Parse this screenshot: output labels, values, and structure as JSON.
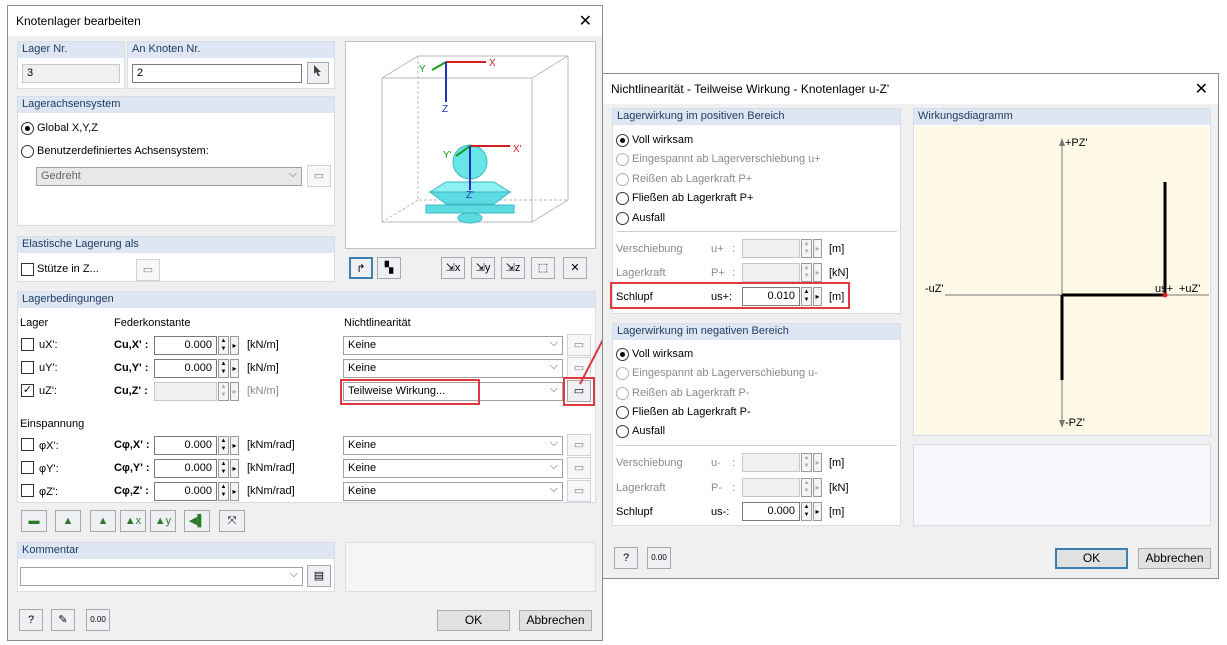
{
  "main": {
    "title": "Knotenlager bearbeiten",
    "lager_nr_label": "Lager Nr.",
    "lager_nr": "3",
    "knoten_label": "An Knoten Nr.",
    "knoten": "2",
    "achs_header": "Lagerachsensystem",
    "global": "Global X,Y,Z",
    "custom": "Benutzerdefiniertes Achsensystem:",
    "custom_dd": "Gedreht",
    "elastic_header": "Elastische Lagerung als",
    "stuetze": "Stütze in Z...",
    "cond_header": "Lagerbedingungen",
    "col_lager": "Lager",
    "col_feder": "Federkonstante",
    "col_nl": "Nichtlinearität",
    "rows": [
      {
        "dof": "uX':",
        "c": "Cu,X' :",
        "val": "0.000",
        "unit": "[kN/m]",
        "nl": "Keine"
      },
      {
        "dof": "uY':",
        "c": "Cu,Y' :",
        "val": "0.000",
        "unit": "[kN/m]",
        "nl": "Keine"
      },
      {
        "dof": "uZ':",
        "c": "Cu,Z' :",
        "val": "",
        "unit": "[kN/m]",
        "nl": "Teilweise Wirkung..."
      }
    ],
    "einsp": "Einspannung",
    "rows2": [
      {
        "dof": "φX':",
        "c": "Cφ,X' :",
        "val": "0.000",
        "unit": "[kNm/rad]",
        "nl": "Keine"
      },
      {
        "dof": "φY':",
        "c": "Cφ,Y' :",
        "val": "0.000",
        "unit": "[kNm/rad]",
        "nl": "Keine"
      },
      {
        "dof": "φZ':",
        "c": "Cφ,Z' :",
        "val": "0.000",
        "unit": "[kNm/rad]",
        "nl": "Keine"
      }
    ],
    "komm_header": "Kommentar",
    "ok": "OK",
    "cancel": "Abbrechen",
    "preview_labels": {
      "x": "X",
      "y": "Y",
      "z": "Z",
      "x2": "X'",
      "y2": "Y'",
      "z2": "Z'"
    }
  },
  "sub": {
    "title": "Nichtlinearität - Teilweise Wirkung - Knotenlager u-Z'",
    "pos_header": "Lagerwirkung im positiven Bereich",
    "pos_opts": [
      "Voll wirksam",
      "Eingespannt ab Lagerverschiebung u+",
      "Reißen ab Lagerkraft P+",
      "Fließen ab Lagerkraft P+",
      "Ausfall"
    ],
    "pos_vers": "Verschiebung",
    "pos_vers_sym": "u+",
    "pos_vers_unit": "[m]",
    "pos_kraft": "Lagerkraft",
    "pos_kraft_sym": "P+",
    "pos_kraft_unit": "[kN]",
    "pos_schlupf": "Schlupf",
    "pos_schlupf_sym": "us+:",
    "pos_schlupf_val": "0.010",
    "pos_schlupf_unit": "[m]",
    "neg_header": "Lagerwirkung im negativen Bereich",
    "neg_opts": [
      "Voll wirksam",
      "Eingespannt ab Lagerverschiebung u-",
      "Reißen ab Lagerkraft P-",
      "Fließen ab Lagerkraft P-",
      "Ausfall"
    ],
    "neg_vers": "Verschiebung",
    "neg_vers_sym": "u-",
    "neg_vers_unit": "[m]",
    "neg_kraft": "Lagerkraft",
    "neg_kraft_sym": "P-",
    "neg_kraft_unit": "[kN]",
    "neg_schlupf": "Schlupf",
    "neg_schlupf_sym": "us-:",
    "neg_schlupf_val": "0.000",
    "neg_schlupf_unit": "[m]",
    "diag_header": "Wirkungsdiagramm",
    "diag_pz": "+PZ'",
    "diag_mpz": "-PZ'",
    "diag_muz": "-uZ'",
    "diag_puz": "+uZ'",
    "diag_us": "us+",
    "ok": "OK",
    "cancel": "Abbrechen"
  }
}
